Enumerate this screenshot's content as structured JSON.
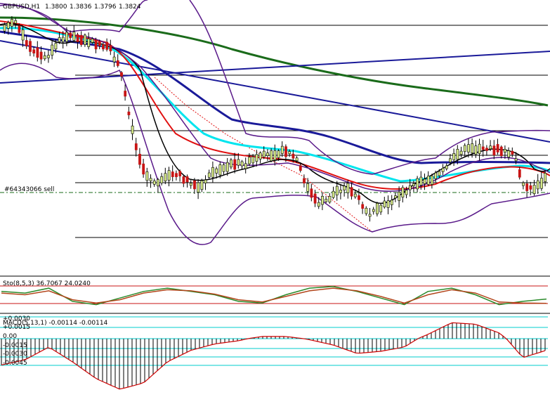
{
  "header": {
    "symbol_timeframe": "GBPUSD,H1",
    "ohlc": [
      "1.3800",
      "1.3836",
      "1.3796",
      "1.3824"
    ]
  },
  "trade_label": "#64343066 sell",
  "sto_label": "Sto(8,5,3) 36.7067 24.0240",
  "macd_label": "MACD(5,13,1) -0.00114 -0.00114",
  "macd_ticks": [
    "+0.0030",
    "+0.0015",
    "0.00",
    "-0.0015",
    "-0.0030",
    "-0.0045"
  ],
  "colors": {
    "ma_green": "#1a6b1a",
    "ma_blue": "#1a1a99",
    "ma_cyan": "#00e5ee",
    "ma_red": "#e01010",
    "ma_black": "#000000",
    "bollinger": "#5a1a8a",
    "level_line": "#000000",
    "bull_candle": "#d8ec8a",
    "bear_candle": "#c81414",
    "sto_main": "#2a8a2a",
    "sto_signal": "#b2451a",
    "sto_levels": "#c81414",
    "macd_signal": "#cc0000",
    "macd_hist": "#000000",
    "macd_levels": "#00cccc"
  },
  "chart_data": [
    {
      "type": "line",
      "title": "GBPUSD,H1",
      "series": [
        {
          "name": "Close",
          "values": [
            1.3855,
            1.3848,
            1.3835,
            1.3815,
            1.379,
            1.3752,
            1.3735,
            1.373,
            1.3738,
            1.3735,
            1.3742,
            1.3746,
            1.3746,
            1.3743,
            1.3733,
            1.3708,
            1.3713,
            1.3727,
            1.3743,
            1.3762,
            1.3752,
            1.3756,
            1.3785,
            1.3782
          ]
        },
        {
          "name": "MA",
          "values": [
            1.3858,
            1.3852,
            1.3843,
            1.3823,
            1.379,
            1.3759,
            1.374,
            1.3735,
            1.3738,
            1.374,
            1.3744,
            1.3746,
            1.3745,
            1.3742,
            1.3733,
            1.3715,
            1.3718,
            1.3729,
            1.3746,
            1.376,
            1.3754,
            1.3757,
            1.3776,
            1.3779
          ]
        }
      ]
    },
    {
      "type": "line",
      "title": "Sto(8,5,3)",
      "ylim": [
        0,
        100
      ],
      "series": [
        {
          "name": "Main",
          "values": [
            60,
            55,
            70,
            30,
            20,
            40,
            60,
            70,
            60,
            50,
            30,
            25,
            50,
            70,
            75,
            60,
            40,
            20,
            60,
            70,
            50,
            20,
            30,
            37
          ]
        },
        {
          "name": "Signal",
          "values": [
            55,
            50,
            62,
            35,
            25,
            35,
            55,
            65,
            62,
            52,
            35,
            28,
            45,
            62,
            70,
            62,
            45,
            25,
            50,
            65,
            55,
            28,
            25,
            24
          ]
        }
      ]
    },
    {
      "type": "bar",
      "title": "MACD(5,13,1)",
      "ylim": [
        -0.006,
        0.0032
      ],
      "values": [
        -0.0025,
        -0.002,
        -0.0008,
        -0.0022,
        -0.0038,
        -0.0048,
        -0.0042,
        -0.0022,
        -0.0011,
        -0.0005,
        -0.0002,
        0.0003,
        0.0003,
        -0.0001,
        -0.0006,
        -0.0014,
        -0.0012,
        -0.0008,
        0.0006,
        0.0022,
        0.002,
        0.0008,
        -0.0018,
        -0.0011
      ]
    }
  ]
}
